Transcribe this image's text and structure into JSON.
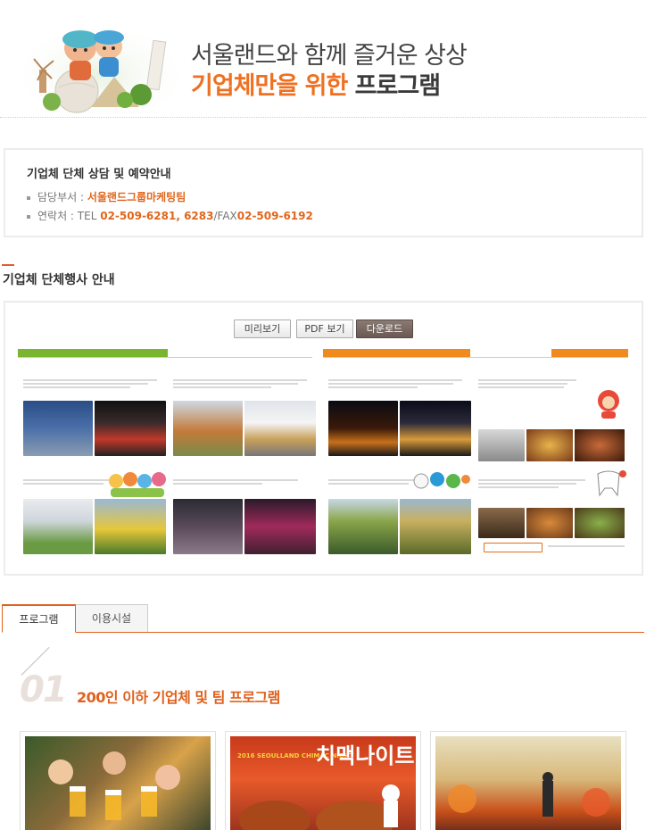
{
  "hero": {
    "line1": "서울랜드와 함께 즐거운 상상",
    "line2_highlight": "기업체만을 위한",
    "line2_rest": " 프로그램"
  },
  "contact": {
    "title": "기업체 단체 상담 및 예약안내",
    "dept_label": "담당부서 : ",
    "dept_value": "서울랜드그룹마케팅팀",
    "phone_label": "연락처 : TEL ",
    "phone_value": "02-509-6281, 6283",
    "fax_label": "/FAX",
    "fax_value": "02-509-6192"
  },
  "section": {
    "title": "기업체 단체행사 안내"
  },
  "buttons": {
    "preview": "미리보기",
    "pdf": "PDF 보기",
    "download": "다운로드"
  },
  "tabs": [
    {
      "label": "프로그램",
      "active": true
    },
    {
      "label": "이용시설",
      "active": false
    }
  ],
  "program": {
    "number": "01",
    "title": "200인 이하 기업체 및 팀 프로그램"
  },
  "cards": [
    {
      "name": "beer-party-photo"
    },
    {
      "name": "chimac-night-photo",
      "banner_text": "치맥나이트",
      "banner_sub": "2016 SEOULLAND CHIMAC NIGHT"
    },
    {
      "name": "outdoor-concert-photo"
    }
  ],
  "colors": {
    "accent": "#e0601c",
    "green": "#7ab530",
    "orange": "#f18a1e"
  }
}
